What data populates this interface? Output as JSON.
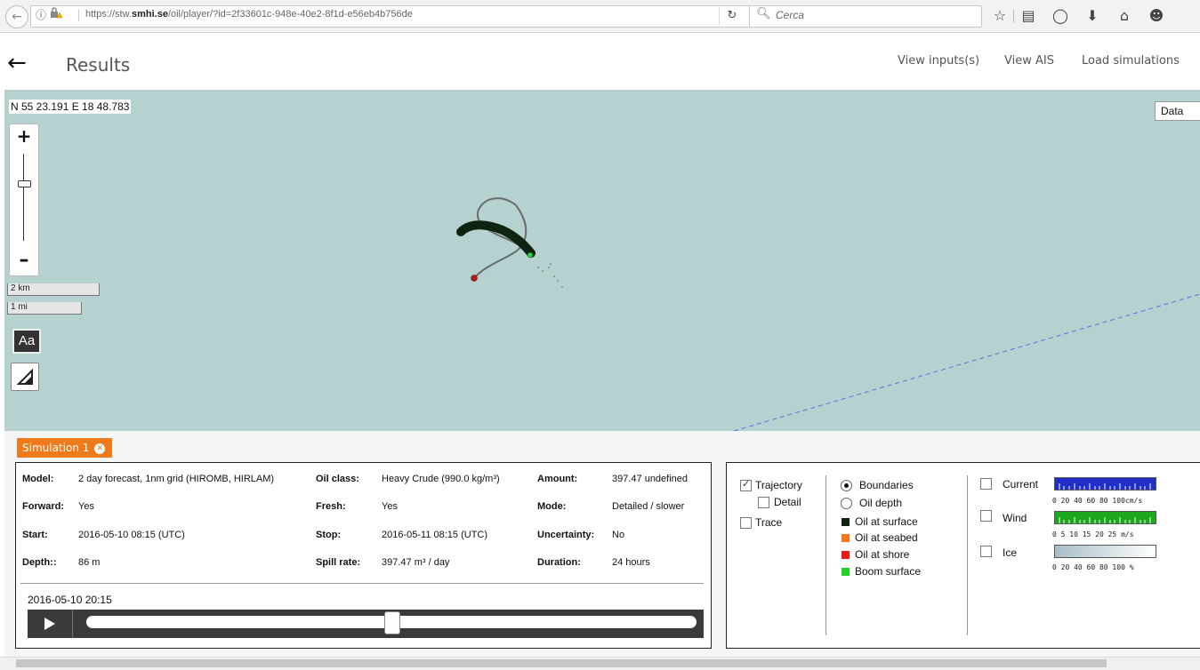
{
  "browser": {
    "url_prefix": "https://stw.",
    "url_domain": "smhi.se",
    "url_path": "/oil/player/?id=2f33601c-948e-40e2-8f1d-e56eb4b756de",
    "search_placeholder": "Cerca"
  },
  "header": {
    "title": "Results",
    "links": [
      "View inputs(s)",
      "View AIS",
      "Load simulations"
    ]
  },
  "map": {
    "coordinate_readout": "N 55 23.191 E 18 48.783",
    "scale_km": "2 km",
    "scale_mi": "1 mi",
    "text_button": "Aa",
    "layer_dropdown": "Data",
    "colors": {
      "water": "#b5d2d1",
      "trajectory": "#6b6b6b",
      "oil_surface": "#0f2410",
      "start_marker": "#b01a1a",
      "end_marker": "#2bd04a",
      "ais_line": "#5a6fe0"
    }
  },
  "simulation": {
    "tab_label": "Simulation 1",
    "fields": {
      "model_label": "Model:",
      "model_value": "2 day forecast, 1nm grid (HIROMB, HIRLAM)",
      "oil_class_label": "Oil class:",
      "oil_class_value": "Heavy Crude (990.0 kg/m³)",
      "amount_label": "Amount:",
      "amount_value": "397.47 undefined",
      "forward_label": "Forward:",
      "forward_value": "Yes",
      "fresh_label": "Fresh:",
      "fresh_value": "Yes",
      "mode_label": "Mode:",
      "mode_value": "Detailed / slower",
      "start_label": "Start:",
      "start_value": "2016-05-10 08:15 (UTC)",
      "stop_label": "Stop:",
      "stop_value": "2016-05-11 08:15 (UTC)",
      "uncertainty_label": "Uncertainty:",
      "uncertainty_value": "No",
      "depth_label": "Depth::",
      "depth_value": "86 m",
      "spill_rate_label": "Spill rate:",
      "spill_rate_value": "397.47 m³ / day",
      "duration_label": "Duration:",
      "duration_value": "24 hours"
    },
    "current_time": "2016-05-10 20:15",
    "playback_fraction": 0.5
  },
  "options": {
    "trajectory": {
      "label": "Trajectory",
      "checked": true
    },
    "detail": {
      "label": "Detail",
      "checked": false
    },
    "trace": {
      "label": "Trace",
      "checked": false
    },
    "boundaries": {
      "label": "Boundaries",
      "selected": true
    },
    "oil_depth": {
      "label": "Oil depth",
      "selected": false
    },
    "legend": [
      {
        "label": "Oil at surface",
        "color": "#0f2410"
      },
      {
        "label": "Oil at seabed",
        "color": "#f07a19"
      },
      {
        "label": "Oil at shore",
        "color": "#e81a1a"
      },
      {
        "label": "Boom surface",
        "color": "#22d22a"
      }
    ],
    "current": {
      "label": "Current",
      "ticks": "0  20  40  60  80  100cm/s",
      "color": "#1f2fc8"
    },
    "wind": {
      "label": "Wind",
      "ticks": "0   5   10  15  20  25  m/s",
      "color": "#1ca81c"
    },
    "ice": {
      "label": "Ice",
      "ticks": "0  20  40  60  80  100 %"
    }
  }
}
